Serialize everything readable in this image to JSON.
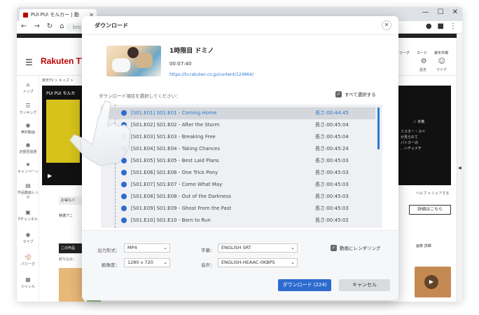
{
  "browser": {
    "tab_title": "PUI PUI モルカー | 動",
    "tab_close": "✕",
    "win_min": "—",
    "win_max": "☐",
    "win_close": "✕",
    "nav_back": "←",
    "nav_forward": "→",
    "nav_reload": "↻",
    "nav_home": "⌂",
    "url_partial": "bro"
  },
  "site": {
    "logo": "Rakuten TV",
    "hamburger": "☰",
    "right_nav": [
      "ピリーグ",
      "カード",
      "楽天市場"
    ],
    "right_labels": [
      "設定",
      "マイデ"
    ],
    "breadcrumb": "楽天TV > キッズ >",
    "sidebar": [
      "トップ",
      "ランキング",
      "無料動画",
      "定額見放題",
      "キャンペーン",
      "作品動画レンタ",
      "Pチャンネル",
      "ライブ",
      "パリーグ",
      "ジャンル"
    ],
    "player_title": "PUI PUI モルカ",
    "player_right_tag": "☆ 本格",
    "player_right_text": "ミスター・スペ\nが見られて\nパトカーの\n、ハチャメチ",
    "under_right": "ヘルプ ⋖ シェアする",
    "btn_right": "詳細はこちら",
    "left_gray1": "お得なパ",
    "left_gray2": "特選アニ",
    "left_black": "この作品",
    "left_note": "絞り込み：",
    "right_mini": "画像  詳細"
  },
  "dialog": {
    "title": "ダウンロード",
    "close": "✕",
    "episode_title": "1時限目 ドミノ",
    "episode_duration": "00:07:40",
    "episode_url": "https://tv.rakuten.co.jp/content/124964/",
    "select_prompt": "ダウンロード項目を選択してください：",
    "select_all": "すべて選択する",
    "episodes": [
      {
        "label": "[S01.E01] S01:E01 - Coming Home",
        "length": "長さ:00:44:45"
      },
      {
        "label": "[S01.E02] S01:E02 - After the Storm",
        "length": "長さ:00:45:04"
      },
      {
        "label": "[S01.E03] S01:E03 - Breaking Free",
        "length": "長さ:00:45:04"
      },
      {
        "label": "[S01.E04] S01:E04 - Taking Chances",
        "length": "長さ:00:45:24"
      },
      {
        "label": "[S01.E05] S01:E05 - Best Laid Plans",
        "length": "長さ:00:45:03"
      },
      {
        "label": "[S01.E06] S01:E06 - One Trick Pony",
        "length": "長さ:00:45:03"
      },
      {
        "label": "[S01.E07] S01:E07 - Come What May",
        "length": "長さ:00:45:03"
      },
      {
        "label": "[S01.E08] S01:E08 - Out of the Darkness",
        "length": "長さ:00:45:03"
      },
      {
        "label": "[S01.E09] S01:E09 - Ghost From the Past",
        "length": "長さ:00:45:03"
      },
      {
        "label": "[S01.E10] S01:E10 - Born to Run",
        "length": "長さ:00:45:02"
      }
    ],
    "options": {
      "format_label": "出力形式：",
      "format_value": "MP4",
      "resolution_label": "解像度：",
      "resolution_value": "1280 x 720",
      "subtitle_label": "字幕：",
      "subtitle_value": "ENGLISH SRT",
      "audio_label": "音声：",
      "audio_value": "ENGLISH-HEAAC-0KBPS",
      "render_label": "動画にレンダリング"
    },
    "download_button": "ダウンロード (224)",
    "cancel_button": "キャンセル"
  },
  "colors": {
    "accent": "#2d6bcf",
    "link": "#2a7ad3",
    "brand": "#bf0000"
  }
}
